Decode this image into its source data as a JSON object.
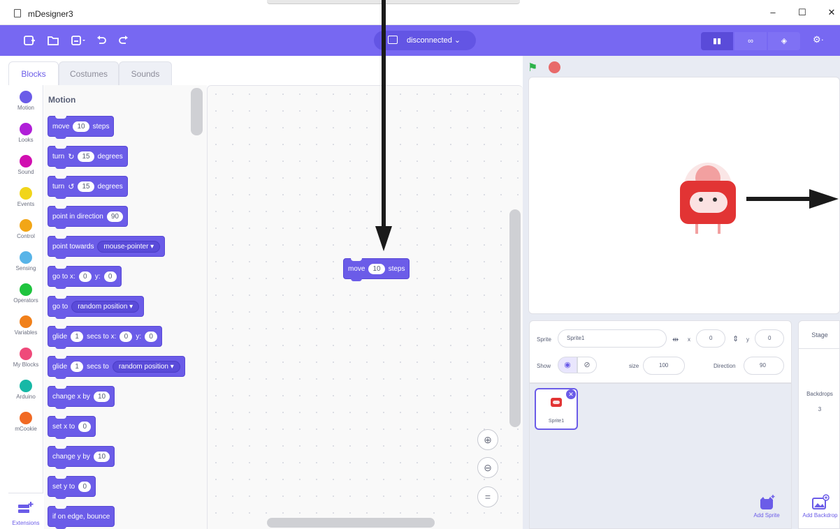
{
  "window": {
    "title": "mDesigner3",
    "minimize": "–",
    "maximize": "☐",
    "close": "✕"
  },
  "menubar": {
    "connection_label": "disconnected ⌄",
    "icons": [
      "new-file-icon",
      "open-folder-icon",
      "save-icon",
      "undo-icon",
      "redo-icon"
    ],
    "mode_icons": [
      "layout-icon",
      "code-view-icon",
      "device-icon"
    ],
    "settings": "⚙·"
  },
  "tabs": {
    "blocks": "Blocks",
    "costumes": "Costumes",
    "sounds": "Sounds"
  },
  "categories": [
    {
      "label": "Motion",
      "color": "#6b5ce8"
    },
    {
      "label": "Looks",
      "color": "#b01fd8"
    },
    {
      "label": "Sound",
      "color": "#d10fb0"
    },
    {
      "label": "Events",
      "color": "#f1d51a"
    },
    {
      "label": "Control",
      "color": "#f2a617"
    },
    {
      "label": "Sensing",
      "color": "#58b4e8"
    },
    {
      "label": "Operators",
      "color": "#1fc43e"
    },
    {
      "label": "Variables",
      "color": "#f1801a"
    },
    {
      "label": "My Blocks",
      "color": "#ef4a7a"
    },
    {
      "label": "Arduino",
      "color": "#17b8a6"
    },
    {
      "label": "mCookie",
      "color": "#f16a24"
    }
  ],
  "extensions_label": "Extensions",
  "palette": {
    "title": "Motion",
    "blocks": {
      "move": {
        "a": "move",
        "v": "10",
        "b": "steps"
      },
      "turn_right": {
        "a": "turn",
        "v": "15",
        "b": "degrees"
      },
      "turn_left": {
        "a": "turn",
        "v": "15",
        "b": "degrees"
      },
      "point_dir": {
        "a": "point in direction",
        "v": "90"
      },
      "point_towards": {
        "a": "point towards",
        "d": "mouse-pointer ▾"
      },
      "goto_xy": {
        "a": "go to x:",
        "x": "0",
        "b": "y:",
        "y": "0"
      },
      "goto": {
        "a": "go to",
        "d": "random position ▾"
      },
      "glide_xy": {
        "a": "glide",
        "v": "1",
        "b": "secs to x:",
        "x": "0",
        "c": "y:",
        "y": "0"
      },
      "glide_to": {
        "a": "glide",
        "v": "1",
        "b": "secs to",
        "d": "random position ▾"
      },
      "change_x": {
        "a": "change x by",
        "v": "10"
      },
      "set_x": {
        "a": "set x to",
        "v": "0"
      },
      "change_y": {
        "a": "change y by",
        "v": "10"
      },
      "set_y": {
        "a": "set y to",
        "v": "0"
      },
      "bounce": {
        "a": "if on edge, bounce"
      }
    }
  },
  "workspace": {
    "block": {
      "a": "move",
      "v": "10",
      "b": "steps"
    }
  },
  "sprite_info": {
    "sprite_label": "Sprite",
    "sprite_name": "Sprite1",
    "x_label": "x",
    "x": "0",
    "y_label": "y",
    "y": "0",
    "show_label": "Show",
    "size_label": "size",
    "size": "100",
    "direction_label": "Direction",
    "direction": "90"
  },
  "sprite_list": [
    {
      "name": "Sprite1"
    }
  ],
  "stage_pane": {
    "title": "Stage",
    "backdrops_label": "Backdrops",
    "backdrops_count": "3"
  },
  "buttons": {
    "add_sprite": "Add Sprite",
    "add_backdrop": "Add Backdrop"
  }
}
